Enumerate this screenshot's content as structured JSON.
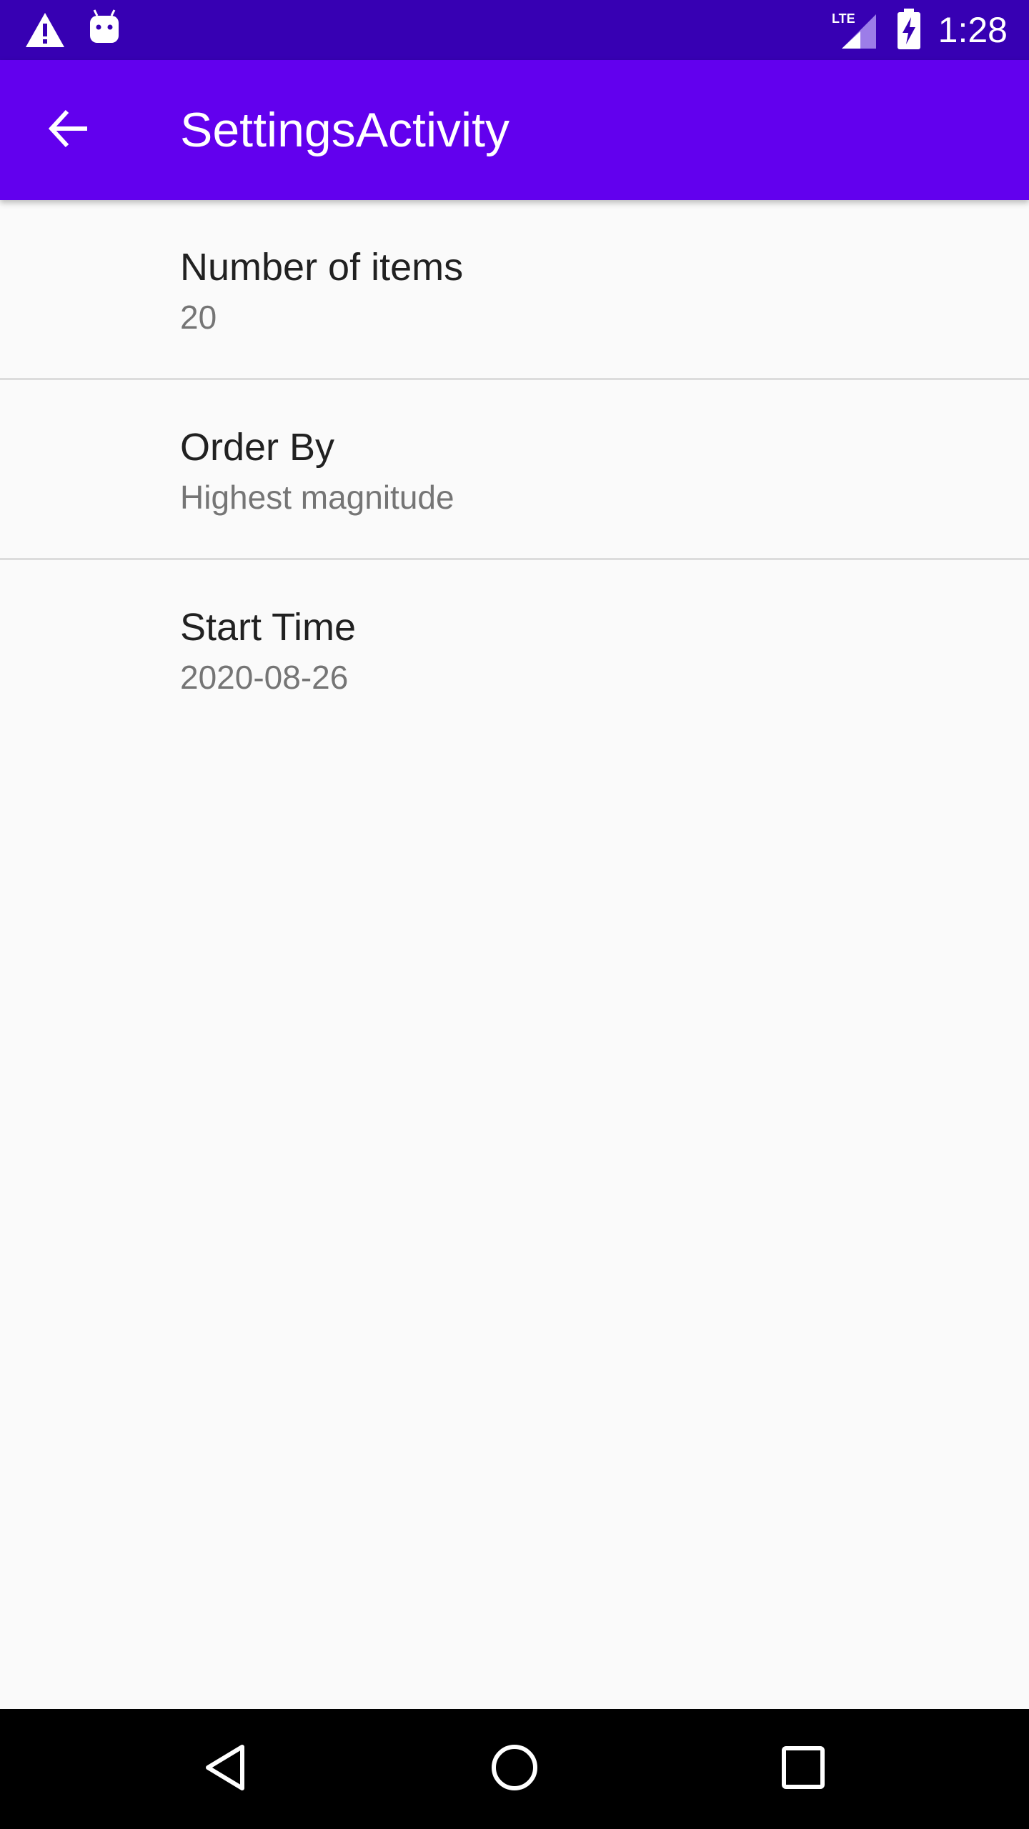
{
  "status_bar": {
    "time": "1:28",
    "network_label": "LTE",
    "icons": [
      "warning-icon",
      "android-icon",
      "lte-signal-icon",
      "battery-charging-icon"
    ]
  },
  "app_bar": {
    "title": "SettingsActivity",
    "back_icon": "arrow-back-icon"
  },
  "preferences": [
    {
      "title": "Number of items",
      "summary": "20"
    },
    {
      "title": "Order By",
      "summary": "Highest magnitude"
    },
    {
      "title": "Start Time",
      "summary": "2020-08-26"
    }
  ],
  "nav_bar": {
    "icons": [
      "nav-back-icon",
      "nav-home-icon",
      "nav-recents-icon"
    ]
  },
  "colors": {
    "status_bar": "#3700b3",
    "app_bar": "#6200ee",
    "background": "#fafafa",
    "divider": "#dcdcdc",
    "title_text": "#212121",
    "summary_text": "#757575",
    "nav_bar": "#000000"
  }
}
